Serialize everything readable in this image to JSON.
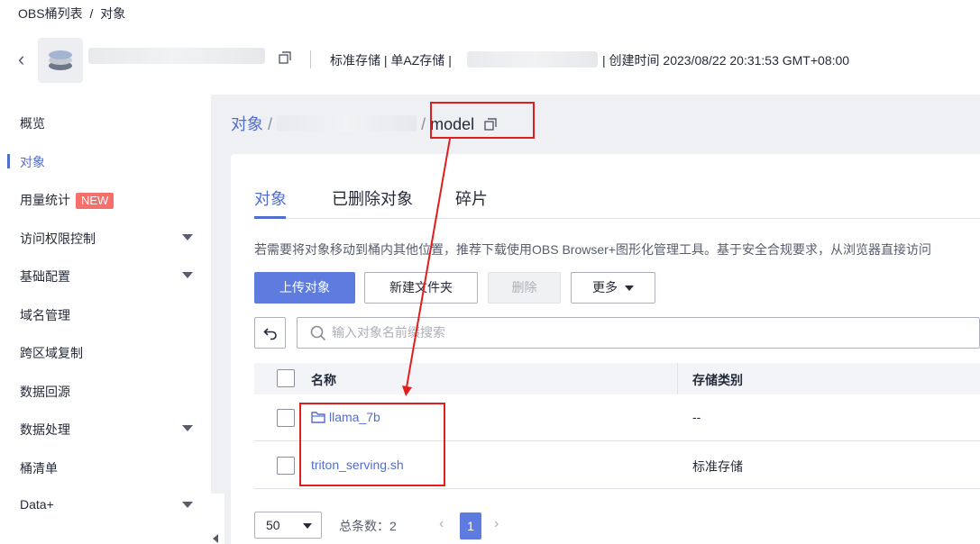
{
  "breadcrumb": {
    "root": "OBS桶列表",
    "sep": "/",
    "current": "对象"
  },
  "header": {
    "storage_info": "标准存储 | 单AZ存储 |",
    "created_info": "| 创建时间  2023/08/22 20:31:53 GMT+08:00"
  },
  "sidebar": {
    "items": [
      {
        "label": "概览"
      },
      {
        "label": "对象"
      },
      {
        "label": "用量统计",
        "badge": "NEW"
      },
      {
        "label": "访问权限控制"
      },
      {
        "label": "基础配置"
      },
      {
        "label": "域名管理"
      },
      {
        "label": "跨区域复制"
      },
      {
        "label": "数据回源"
      },
      {
        "label": "数据处理"
      },
      {
        "label": "桶清单"
      },
      {
        "label": "Data+"
      }
    ]
  },
  "path": {
    "root": "对象",
    "sep1": "/",
    "sep2": "/",
    "current": "model"
  },
  "tabs": [
    {
      "label": "对象"
    },
    {
      "label": "已删除对象"
    },
    {
      "label": "碎片"
    }
  ],
  "tip": "若需要将对象移动到桶内其他位置，推荐下载使用OBS Browser+图形化管理工具。基于安全合规要求，从浏览器直接访问",
  "toolbar": {
    "upload": "上传对象",
    "new_folder": "新建文件夹",
    "delete": "删除",
    "more": "更多"
  },
  "search": {
    "placeholder": "输入对象名前缀搜索"
  },
  "table": {
    "columns": [
      "名称",
      "存储类别"
    ],
    "rows": [
      {
        "name": "llama_7b",
        "type": "--",
        "is_folder": true
      },
      {
        "name": "triton_serving.sh",
        "type": "标准存储",
        "is_folder": false
      }
    ]
  },
  "pagination": {
    "page_size": "50",
    "total": "总条数：2",
    "current_page": "1",
    "prev": "‹",
    "next": "›"
  },
  "colors": {
    "accent": "#526ecc",
    "primary_button": "#5e7ce0",
    "annotation": "#e11d1d",
    "badge": "#f66f6a"
  }
}
